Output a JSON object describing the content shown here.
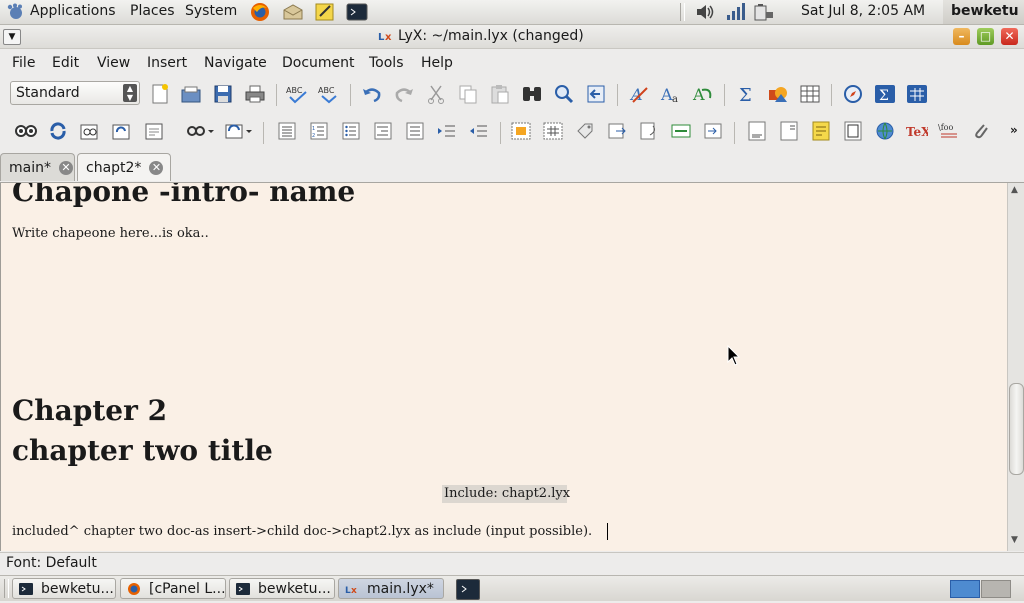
{
  "panel": {
    "menus": [
      "Applications",
      "Places",
      "System"
    ],
    "clock": "Sat Jul  8,  2:05 AM",
    "user": "bewketu"
  },
  "window": {
    "title": "LyX: ~/main.lyx (changed)"
  },
  "menubar": [
    "File",
    "Edit",
    "View",
    "Insert",
    "Navigate",
    "Document",
    "Tools",
    "Help"
  ],
  "toolbar": {
    "layout_value": "Standard"
  },
  "tabs": [
    {
      "label": "main*"
    },
    {
      "label": "chapt2*"
    }
  ],
  "document": {
    "heading1": "Chapone -intro- name",
    "para1": "Write chapeone here...is oka..",
    "chapter_number": "Chapter 2",
    "chapter_title": "chapter two title",
    "include_inset": "Include: chapt2.lyx",
    "para2": "included^ chapter two doc-as insert->child doc->chapt2.lyx as include (input possible)."
  },
  "statusbar": {
    "text": "Font: Default"
  },
  "taskbar": [
    {
      "label": "bewketu...",
      "icon": "terminal-icon"
    },
    {
      "label": "[cPanel L...",
      "icon": "firefox-icon"
    },
    {
      "label": "bewketu...",
      "icon": "terminal-icon"
    },
    {
      "label": "main.lyx*",
      "icon": "lyx-icon"
    }
  ]
}
